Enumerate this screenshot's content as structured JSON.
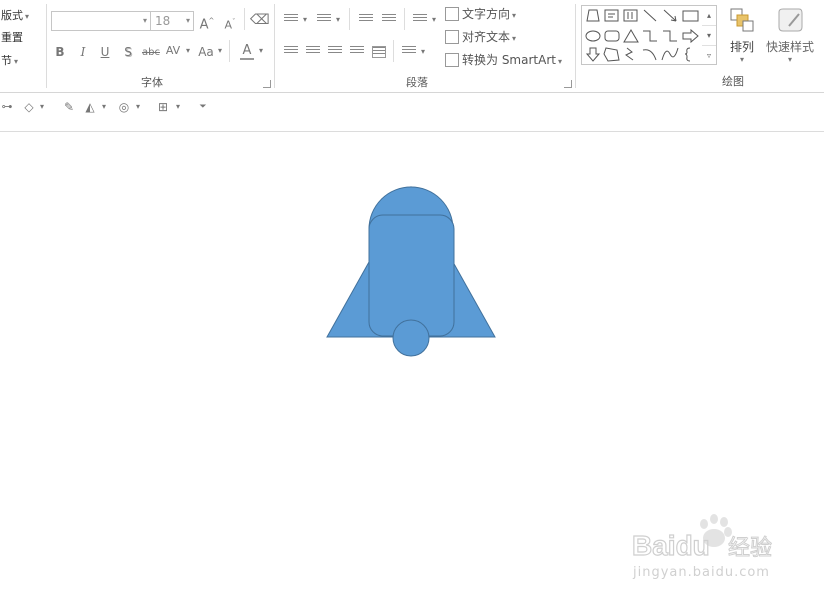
{
  "ribbon": {
    "slides": {
      "layout_label": "版式",
      "reset_label": "重置",
      "section_label": "节"
    },
    "font": {
      "group_label": "字体",
      "font_name_value": "",
      "font_size_value": "18",
      "bold": "B",
      "italic": "I",
      "underline": "U",
      "shadow": "S",
      "strike": "abc",
      "spacing": "AV",
      "case": "Aa",
      "color": "A"
    },
    "paragraph": {
      "group_label": "段落",
      "text_direction_label": "文字方向",
      "align_text_label": "对齐文本",
      "smartart_label": "转换为 SmartArt"
    },
    "drawing": {
      "group_label": "绘图",
      "arrange_label": "排列",
      "quick_styles_label": "快速样式"
    }
  },
  "colors": {
    "shape_fill": "#5b9bd5",
    "shape_stroke": "#41719c",
    "ribbon_sep": "#dcdcdc"
  },
  "watermark": {
    "brand": "Baidu",
    "suffix": "经验",
    "url": "jingyan.baidu.com"
  }
}
